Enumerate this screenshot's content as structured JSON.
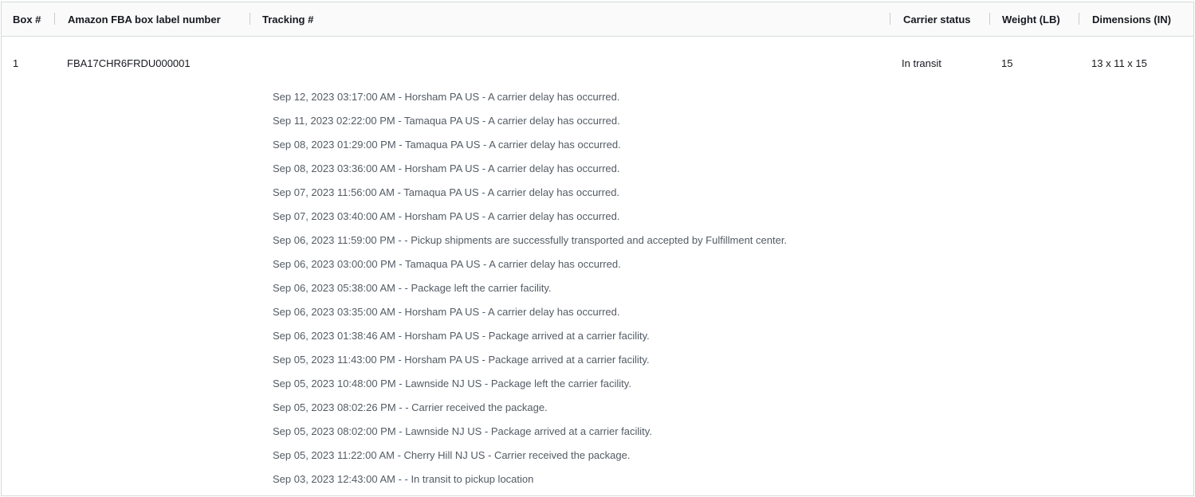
{
  "table": {
    "headers": {
      "box": "Box #",
      "label_number": "Amazon FBA box label number",
      "tracking": "Tracking #",
      "carrier_status": "Carrier status",
      "weight": "Weight (LB)",
      "dimensions": "Dimensions (IN)"
    },
    "row": {
      "box": "1",
      "label_number": "FBA17CHR6FRDU000001",
      "carrier_status": "In transit",
      "weight": "15",
      "dimensions": "13 x 11 x 15"
    },
    "tracking_events": [
      "Sep 12, 2023 03:17:00 AM - Horsham PA US - A carrier delay has occurred.",
      "Sep 11, 2023 02:22:00 PM - Tamaqua PA US - A carrier delay has occurred.",
      "Sep 08, 2023 01:29:00 PM - Tamaqua PA US - A carrier delay has occurred.",
      "Sep 08, 2023 03:36:00 AM - Horsham PA US - A carrier delay has occurred.",
      "Sep 07, 2023 11:56:00 AM - Tamaqua PA US - A carrier delay has occurred.",
      "Sep 07, 2023 03:40:00 AM - Horsham PA US - A carrier delay has occurred.",
      "Sep 06, 2023 11:59:00 PM - - Pickup shipments are successfully transported and accepted by Fulfillment center.",
      "Sep 06, 2023 03:00:00 PM - Tamaqua PA US - A carrier delay has occurred.",
      "Sep 06, 2023 05:38:00 AM - - Package left the carrier facility.",
      "Sep 06, 2023 03:35:00 AM - Horsham PA US - A carrier delay has occurred.",
      "Sep 06, 2023 01:38:46 AM - Horsham PA US - Package arrived at a carrier facility.",
      "Sep 05, 2023 11:43:00 PM - Horsham PA US - Package arrived at a carrier facility.",
      "Sep 05, 2023 10:48:00 PM - Lawnside NJ US - Package left the carrier facility.",
      "Sep 05, 2023 08:02:26 PM - - Carrier received the package.",
      "Sep 05, 2023 08:02:00 PM - Lawnside NJ US - Package arrived at a carrier facility.",
      "Sep 05, 2023 11:22:00 AM - Cherry Hill NJ US - Carrier received the package.",
      "Sep 03, 2023 12:43:00 AM - - In transit to pickup location"
    ]
  }
}
